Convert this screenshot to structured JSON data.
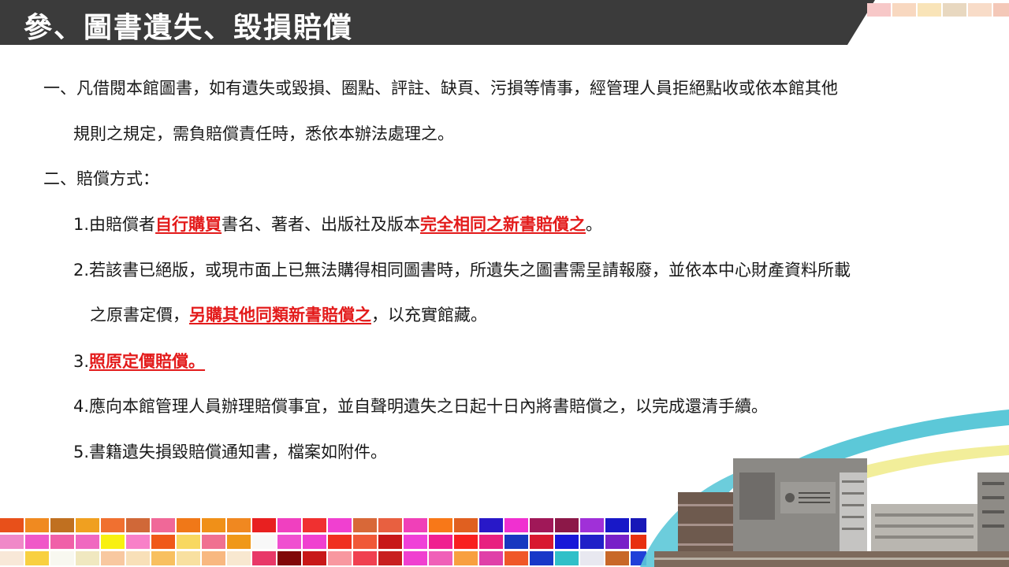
{
  "title": "參、圖書遺失、毀損賠償",
  "section1": {
    "line1": "一、凡借閱本館圖書，如有遺失或毀損、圈點、評註、缺頁、污損等情事，經管理人員拒絕點收或依本館其他",
    "line2": "規則之規定，需負賠償責任時，悉依本辦法處理之。"
  },
  "section2": {
    "heading": "二、賠償方式：",
    "item1": {
      "prefix": "1.由賠償者",
      "highlight1": "自行購買",
      "middle": "書名、著者、出版社及版本",
      "highlight2": "完全相同之新書賠償之",
      "suffix": "。"
    },
    "item2": {
      "line1": "2.若該書已絕版，或現市面上已無法購得相同圖書時，所遺失之圖書需呈請報廢，並依本中心財產資料所載",
      "line2_prefix": "之原書定價，",
      "highlight": "另購其他同類新書賠償之",
      "line2_suffix": "，以充實館藏。"
    },
    "item3": {
      "prefix": "3.",
      "highlight": "照原定價賠償。"
    },
    "item4": "4.應向本館管理人員辦理賠償事宜，並自聲明遺失之日起十日內將書賠償之，以完成還清手續。",
    "item5": "5.書籍遺失損毀賠償通知書，檔案如附件。"
  },
  "top_tile_colors": [
    "#f7c8c8",
    "#f8d8c0",
    "#f9e4b8",
    "#e8d8c0",
    "#f8dcc8",
    "#f4c8b8"
  ],
  "mosaic_rows": [
    [
      "#e8501a",
      "#f08a20",
      "#c07020",
      "#f0a020",
      "#f07030",
      "#d06838",
      "#f06898",
      "#f07818",
      "#f09018",
      "#f08820",
      "#e82020",
      "#f040c0",
      "#f03030",
      "#f040d0",
      "#d86838",
      "#e86040",
      "#f040b8",
      "#f87818",
      "#e06020",
      "#2818c8",
      "#f030d0",
      "#a01858",
      "#8c1848",
      "#a030d8",
      "#1818c8",
      "#1818b8"
    ],
    [
      "#f088c8",
      "#f058c8",
      "#f060a8",
      "#f068c0",
      "#f8f010",
      "#f880c8",
      "#f05818",
      "#f8d860",
      "#f07090",
      "#f09818",
      "#f8f8f8",
      "#f050d0",
      "#f040d0",
      "#f03020",
      "#f05838",
      "#c81818",
      "#f040d8",
      "#f02090",
      "#f82020",
      "#e82080",
      "#1838c0",
      "#d81830",
      "#1818d8",
      "#2020c8",
      "#7820c8",
      "#e83010"
    ],
    [
      "#f8e8d8",
      "#f8d040",
      "#f8f8f0",
      "#f0e8c0",
      "#f8c8a0",
      "#f8e0b8",
      "#f8c060",
      "#f8e0a0",
      "#f8b880",
      "#f8e8d0",
      "#e83868",
      "#800808",
      "#c81818",
      "#f898a0",
      "#f04050",
      "#c82020",
      "#f040d0",
      "#f060b8",
      "#f8a040",
      "#e040a8",
      "#f05828",
      "#1838c8",
      "#30c0c8",
      "#e8e8f0",
      "#c86828",
      "#2040d8"
    ]
  ]
}
